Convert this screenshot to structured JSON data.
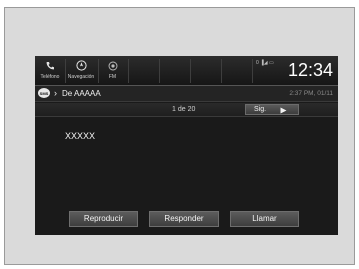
{
  "status_bar": {
    "phone_label": "Teléfono",
    "nav_label": "Navegación",
    "fm_label": "FM",
    "clock": "12:34",
    "indicators": "0 ▐◢ ▭"
  },
  "header": {
    "badge": "SMS",
    "from": "De AAAAA",
    "datetime": "2:37 PM, 01/11"
  },
  "pager": {
    "count": "1 de 20",
    "next_label": "Sig."
  },
  "message": {
    "body": "XXXXX"
  },
  "actions": {
    "play_label": "Reproducir",
    "reply_label": "Responder",
    "call_label": "Llamar"
  },
  "icons": {
    "phone": "phone-icon",
    "navigation": "compass-icon",
    "radio": "radio-icon",
    "next": "play-triangle-icon"
  }
}
